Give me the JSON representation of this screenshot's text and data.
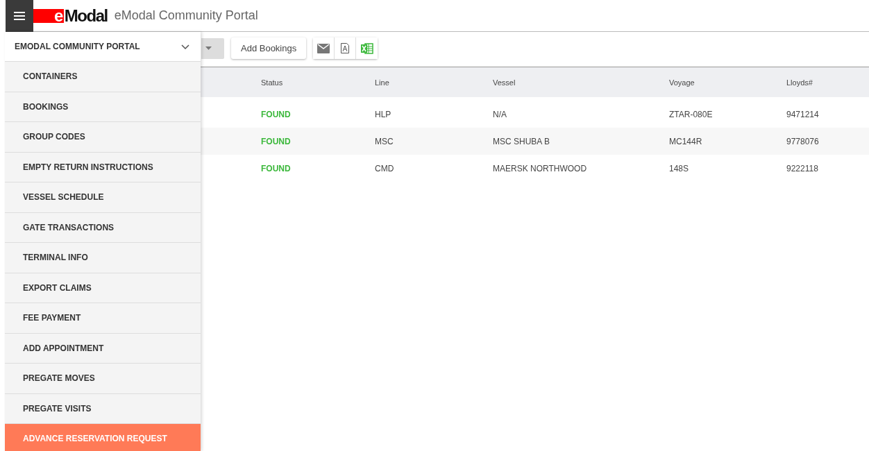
{
  "header": {
    "logo": "eModal",
    "title": "eModal Community Portal"
  },
  "toolbar": {
    "button": "Add Bookings"
  },
  "table": {
    "columns": [
      "Status",
      "Line",
      "Vessel",
      "Voyage",
      "Lloyds#"
    ],
    "rows": [
      [
        "FOUND",
        "HLP",
        "N/A",
        "ZTAR-080E",
        "9471214"
      ],
      [
        "FOUND",
        "MSC",
        "MSC SHUBA B",
        "MC144R",
        "9778076"
      ],
      [
        "FOUND",
        "CMD",
        "MAERSK NORTHWOOD",
        "148S",
        "9222118"
      ]
    ]
  },
  "sidebar": {
    "title": "EMODAL COMMUNITY PORTAL",
    "expanded": true,
    "items": [
      {
        "label": "CONTAINERS",
        "selected": false
      },
      {
        "label": "BOOKINGS",
        "selected": false
      },
      {
        "label": "GROUP CODES",
        "selected": false
      },
      {
        "label": "EMPTY RETURN INSTRUCTIONS",
        "selected": false
      },
      {
        "label": "VESSEL SCHEDULE",
        "selected": false
      },
      {
        "label": "GATE TRANSACTIONS",
        "selected": false
      },
      {
        "label": "TERMINAL INFO",
        "selected": false
      },
      {
        "label": "EXPORT CLAIMS",
        "selected": false
      },
      {
        "label": "FEE PAYMENT",
        "selected": false
      },
      {
        "label": "ADD APPOINTMENT",
        "selected": false
      },
      {
        "label": "PREGATE MOVES",
        "selected": false
      },
      {
        "label": "PREGATE VISITS",
        "selected": false
      },
      {
        "label": "ADVANCE RESERVATION REQUEST",
        "selected": true
      }
    ]
  }
}
